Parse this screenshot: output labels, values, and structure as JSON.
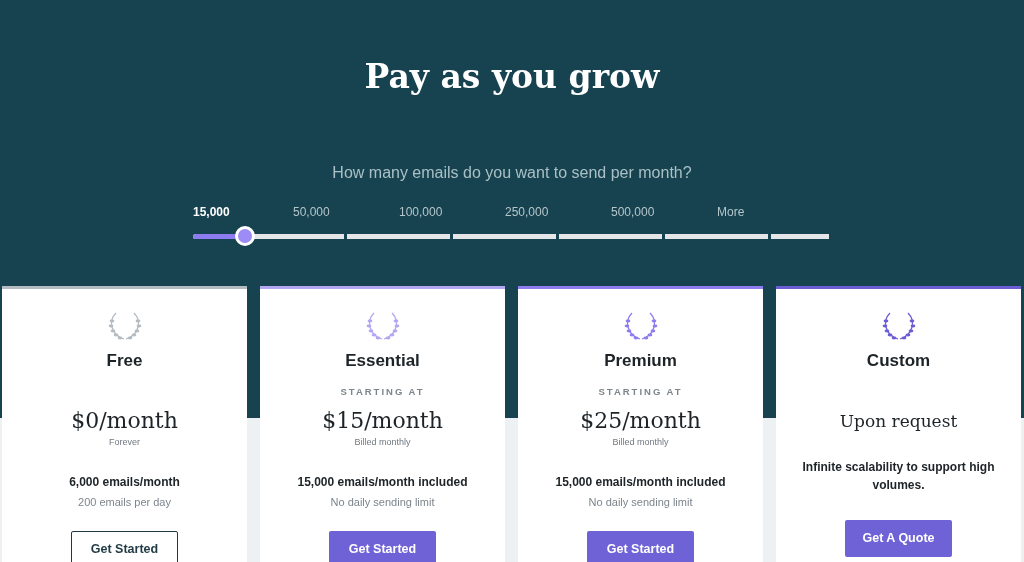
{
  "title": "Pay as you grow",
  "slider": {
    "question": "How many emails do you want to send per month?",
    "level": 0.082,
    "ticks": [
      {
        "label": "15,000",
        "selected": true
      },
      {
        "label": "50,000",
        "selected": false
      },
      {
        "label": "100,000",
        "selected": false
      },
      {
        "label": "250,000",
        "selected": false
      },
      {
        "label": "500,000",
        "selected": false
      },
      {
        "label": "More",
        "selected": false
      }
    ]
  },
  "plans": [
    {
      "name": "Free",
      "color": "#b4bcc2",
      "price": "$0/month",
      "kind": "amount",
      "note": "Forever",
      "feature": "6,000 emails/month",
      "feature_note": "200 emails per day",
      "button": {
        "label": "Get Started",
        "kind": "outline"
      }
    },
    {
      "name": "Essential",
      "color": "#b3a6f2",
      "starting": "STARTING AT",
      "price": "$15/month",
      "kind": "amount",
      "note": "Billed monthly",
      "feature": "15,000 emails/month included",
      "feature_note": "No daily sending limit",
      "button": {
        "label": "Get Started",
        "kind": "filled"
      }
    },
    {
      "name": "Premium",
      "color": "#8f7cee",
      "starting": "STARTING AT",
      "price": "$25/month",
      "kind": "amount",
      "note": "Billed monthly",
      "feature": "15,000 emails/month included",
      "feature_note": "No daily sending limit",
      "button": {
        "label": "Get Started",
        "kind": "filled"
      }
    },
    {
      "name": "Custom",
      "color": "#6c5dd6",
      "price": "Upon request",
      "kind": "text",
      "description": "Infinite scalability to support high volumes.",
      "button": {
        "label": "Get A Quote",
        "kind": "filled"
      }
    }
  ]
}
